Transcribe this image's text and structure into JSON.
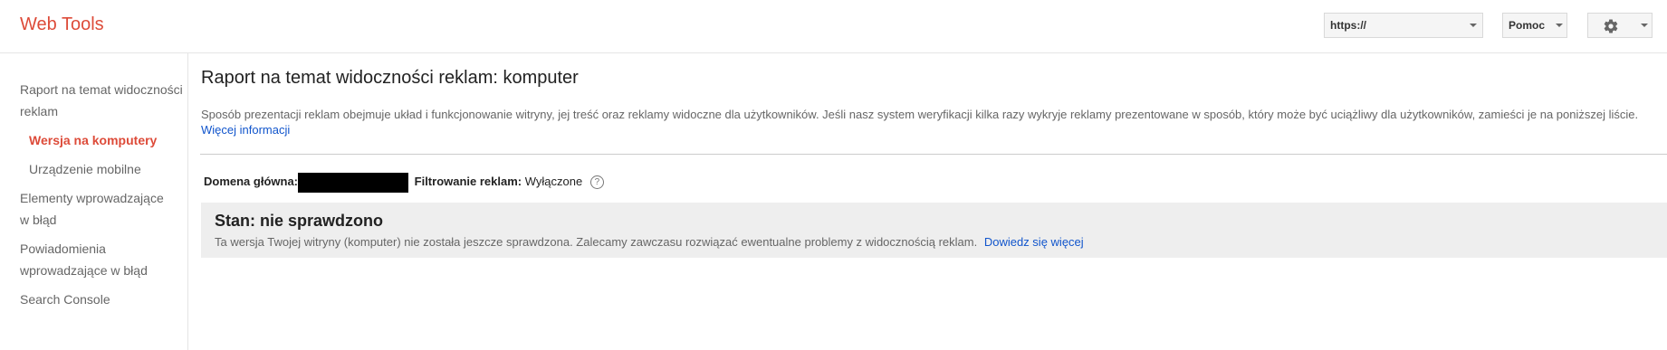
{
  "app": {
    "logo": "Web Tools"
  },
  "header": {
    "url_select_value": "https://",
    "help_label": "Pomoc"
  },
  "sidebar": {
    "items": [
      {
        "label": "Raport na temat widoczności reklam",
        "line1": "Raport na temat widoczności",
        "line2": "reklam"
      },
      {
        "label": "Wersja na komputery"
      },
      {
        "label": "Urządzenie mobilne"
      },
      {
        "label": "Elementy wprowadzające w błąd",
        "line1": "Elementy wprowadzające",
        "line2": "w błąd"
      },
      {
        "label": "Powiadomienia wprowadzające w błąd",
        "line1": "Powiadomienia",
        "line2": "wprowadzające w błąd"
      },
      {
        "label": "Search Console"
      }
    ]
  },
  "main": {
    "title": "Raport na temat widoczności reklam: komputer",
    "description": "Sposób prezentacji reklam obejmuje układ i funkcjonowanie witryny, jej treść oraz reklamy widoczne dla użytkowników. Jeśli nasz system weryfikacji kilka razy wykryje reklamy prezentowane w sposób, który może być uciążliwy dla użytkowników, zamieści je na poniższej liście.",
    "learn_more": "Więcej informacji",
    "domain_label": "Domena główna:",
    "filter_label": "Filtrowanie reklam:",
    "filter_value": "Wyłączone",
    "help_icon_glyph": "?",
    "status": {
      "title": "Stan: nie sprawdzono",
      "text": "Ta wersja Twojej witryny (komputer) nie została jeszcze sprawdzona. Zalecamy zawczasu rozwiązać ewentualne problemy z widocznością reklam.",
      "link": "Dowiedz się więcej"
    }
  },
  "colors": {
    "brand": "#dd4b39",
    "link": "#1155cc",
    "status_bg": "#eeeeee"
  }
}
